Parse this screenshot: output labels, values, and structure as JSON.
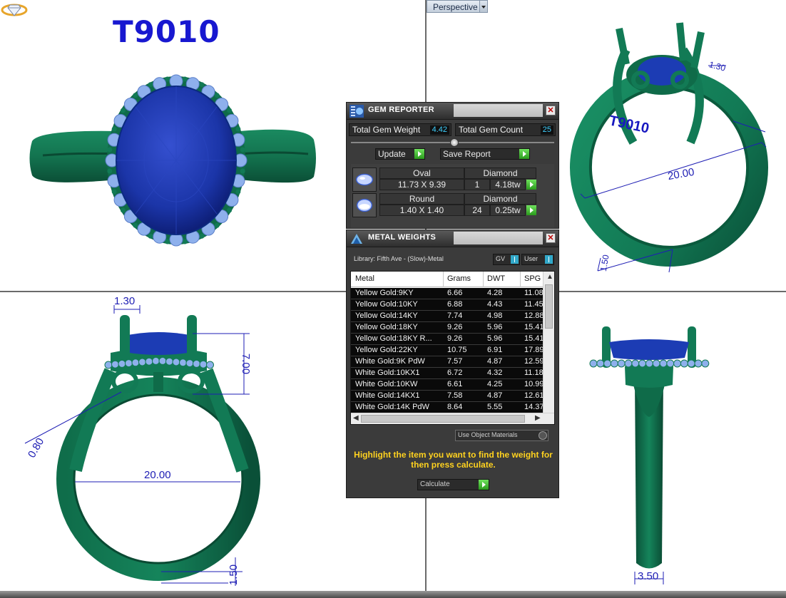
{
  "viewport": {
    "model_id": "T9010",
    "view_mode": "Perspective",
    "dims": {
      "tr_top": "1.30",
      "tr_finger": "20.00",
      "tr_base": "1.50",
      "bl_top": "1.30",
      "bl_height": "7.00",
      "bl_side": "0.80",
      "bl_finger": "20.00",
      "bl_base": "1.50",
      "br_shank": "3.50"
    }
  },
  "gem_reporter": {
    "title": "GEM REPORTER",
    "total_weight_label": "Total Gem Weight",
    "total_weight_value": "4.42",
    "total_count_label": "Total Gem Count",
    "total_count_value": "25",
    "update_label": "Update",
    "save_report_label": "Save Report",
    "gems": [
      {
        "shape": "Oval",
        "material": "Diamond",
        "size": "11.73 X 9.39",
        "count": "1",
        "weight": "4.18tw"
      },
      {
        "shape": "Round",
        "material": "Diamond",
        "size": "1.40 X 1.40",
        "count": "24",
        "weight": "0.25tw"
      }
    ]
  },
  "metal_weights": {
    "title": "METAL WEIGHTS",
    "library": "Library: Fifth Ave - (Slow)-Metal",
    "gv_label": "GV",
    "user_label": "User",
    "columns": [
      "Metal",
      "Grams",
      "DWT",
      "SPG"
    ],
    "rows": [
      [
        "Yellow Gold:9KY",
        "6.66",
        "4.28",
        "11.08"
      ],
      [
        "Yellow Gold:10KY",
        "6.88",
        "4.43",
        "11.45"
      ],
      [
        "Yellow Gold:14KY",
        "7.74",
        "4.98",
        "12.88"
      ],
      [
        "Yellow Gold:18KY",
        "9.26",
        "5.96",
        "15.41"
      ],
      [
        "Yellow Gold:18KY R...",
        "9.26",
        "5.96",
        "15.41"
      ],
      [
        "Yellow Gold:22KY",
        "10.75",
        "6.91",
        "17.89"
      ],
      [
        "White Gold:9K PdW",
        "7.57",
        "4.87",
        "12.59"
      ],
      [
        "White Gold:10KX1",
        "6.72",
        "4.32",
        "11.18"
      ],
      [
        "White Gold:10KW",
        "6.61",
        "4.25",
        "10.99"
      ],
      [
        "White Gold:14KX1",
        "7.58",
        "4.87",
        "12.61"
      ],
      [
        "White Gold:14K PdW",
        "8.64",
        "5.55",
        "14.37"
      ]
    ],
    "use_object_materials": "Use Object Materials",
    "hint": "Highlight the item you want to find the weight for then press calculate.",
    "calculate_label": "Calculate"
  },
  "colors": {
    "metal": "#127a55",
    "center_stone": "#1c3cb4",
    "halo_stone": "#8eb0ec",
    "dimension": "#1e1eb4",
    "panel_bg": "#3b3b3b",
    "accent_value": "#3fd0ff",
    "hint_text": "#ffd21f"
  }
}
